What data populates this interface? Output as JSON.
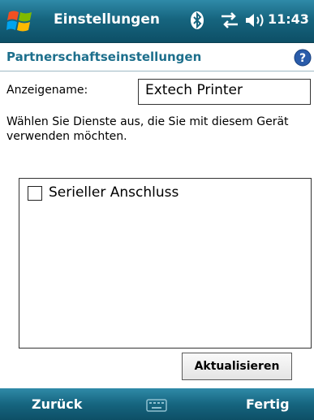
{
  "titlebar": {
    "title": "Einstellungen",
    "time": "11:43",
    "icons": [
      "windows-start-icon",
      "bluetooth-icon",
      "connectivity-icon",
      "volume-icon"
    ]
  },
  "section": {
    "title": "Partnerschaftseinstellungen",
    "help_icon": "help-icon"
  },
  "form": {
    "display_name_label": "Anzeigename:",
    "display_name_value": "Extech Printer",
    "instruction": "Wählen Sie Dienste aus, die Sie mit diesem Gerät verwenden möchten.",
    "services": [
      {
        "label": "Serieller Anschluss",
        "checked": false
      }
    ],
    "update_button": "Aktualisieren"
  },
  "softkeys": {
    "left": "Zurück",
    "right": "Fertig",
    "center_icon": "keyboard-icon"
  },
  "colors": {
    "bar": "#16657f",
    "accent_text": "#1d6f8c"
  }
}
